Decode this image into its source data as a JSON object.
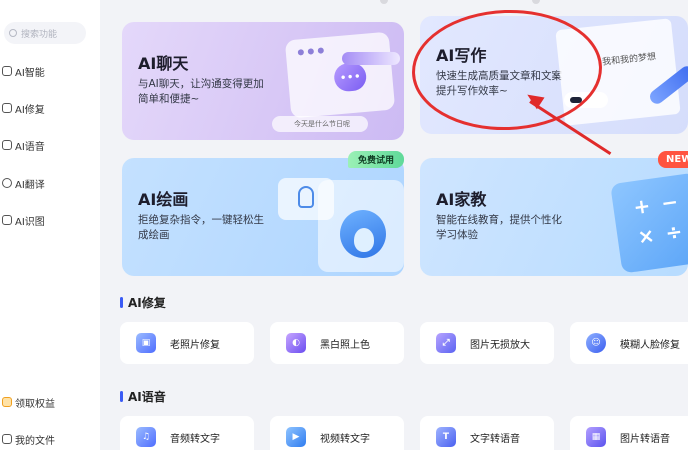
{
  "sidebar": {
    "search_placeholder": "搜索功能",
    "items": [
      {
        "label": "AI智能"
      },
      {
        "label": "AI修复"
      },
      {
        "label": "AI语音"
      },
      {
        "label": "AI翻译"
      },
      {
        "label": "AI识图"
      }
    ],
    "bottom": [
      {
        "label": "领取权益"
      },
      {
        "label": "我的文件"
      }
    ]
  },
  "cards": {
    "chat": {
      "title": "AI聊天",
      "desc_line1": "与AI聊天，让沟通变得更加",
      "desc_line2": "简单和便捷~",
      "pill": "今天是什么节日呢"
    },
    "write": {
      "title": "AI写作",
      "desc_line1": "快速生成高质量文章和文案",
      "desc_line2": "提升写作效率~",
      "book_text": "我和我的梦想"
    },
    "draw": {
      "title": "AI绘画",
      "desc_line1": "拒绝复杂指令，一键轻松生",
      "desc_line2": "成绘画",
      "badge": "免费试用"
    },
    "tutor": {
      "title": "AI家教",
      "desc_line1": "智能在线教育，提供个性化",
      "desc_line2": "学习体验",
      "badge": "NEW"
    }
  },
  "sections": {
    "repair": {
      "title": "AI修复",
      "tools": [
        {
          "label": "老照片修复",
          "icon": "photo-restore-icon"
        },
        {
          "label": "黑白照上色",
          "icon": "colorize-icon"
        },
        {
          "label": "图片无损放大",
          "icon": "upscale-icon"
        },
        {
          "label": "模糊人脸修复",
          "icon": "face-restore-icon"
        }
      ]
    },
    "voice": {
      "title": "AI语音",
      "tools": [
        {
          "label": "音频转文字",
          "icon": "audio-to-text-icon"
        },
        {
          "label": "视频转文字",
          "icon": "video-to-text-icon"
        },
        {
          "label": "文字转语音",
          "icon": "text-to-speech-icon"
        },
        {
          "label": "图片转语音",
          "icon": "image-to-speech-icon"
        }
      ]
    }
  },
  "colors": {
    "accent": "#3a5bf5",
    "annotation_red": "#e02a2a",
    "free_badge": "#5fd999",
    "new_badge": "#ff5440"
  }
}
